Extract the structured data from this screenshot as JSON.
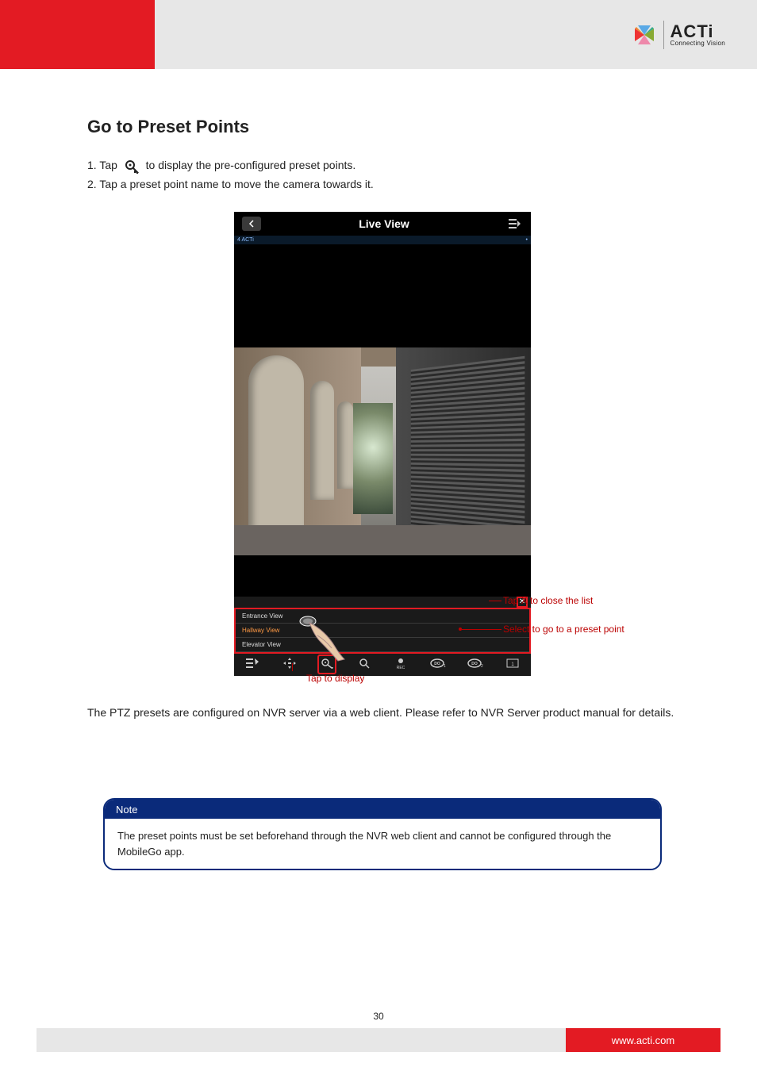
{
  "brand": {
    "name": "ACTi",
    "tagline": "Connecting Vision"
  },
  "heading": "Go to Preset Points",
  "text": {
    "line1_pre": "1.   Tap",
    "line1_post": "to display the pre-configured preset points.",
    "line2": "2.   Tap a preset point name to move the camera towards it.",
    "para2": "The PTZ presets are configured on NVR server via a web client. Please refer to NVR Server product manual for details."
  },
  "phone": {
    "title": "Live View",
    "mini_label_left": "4 ACTi",
    "presets": [
      "Entrance View",
      "Hallway View",
      "Elevator View"
    ],
    "selected_index": 1,
    "bottom_rec": "REC",
    "bottom_do1": "DO",
    "bottom_do2": "DO"
  },
  "callouts": {
    "x": "Tap X to close the list",
    "preset": "Select to go to a preset point",
    "btn": "Tap to display"
  },
  "note": {
    "title": "Note",
    "body": "The preset points must be set beforehand through the NVR web client and cannot be configured through the MobileGo app."
  },
  "footer": {
    "url": "www.acti.com",
    "page_number": "30"
  }
}
